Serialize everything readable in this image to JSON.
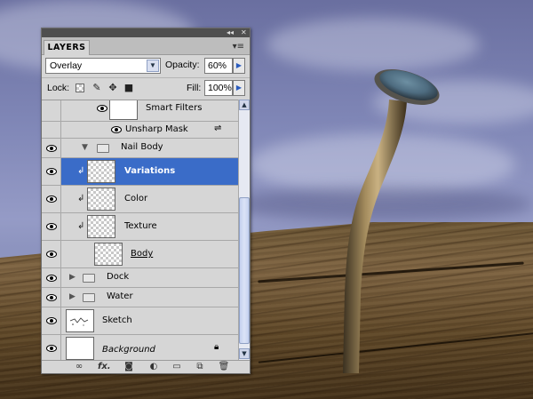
{
  "panel": {
    "tab_label": "LAYERS",
    "menu_icon": "panel-menu-icon",
    "collapse_glyph": "◂◂",
    "close_glyph": "✕",
    "blend_mode": "Overlay",
    "opacity_label": "Opacity:",
    "opacity_value": "60%",
    "lock_label": "Lock:",
    "fill_label": "Fill:",
    "fill_value": "100%"
  },
  "layers": [
    {
      "name": "Smart Filters",
      "kind": "smart-filters"
    },
    {
      "name": "Unsharp Mask",
      "kind": "filter"
    },
    {
      "name": "Nail Body",
      "kind": "group-open"
    },
    {
      "name": "Variations",
      "kind": "clipped",
      "selected": true
    },
    {
      "name": "Color",
      "kind": "clipped"
    },
    {
      "name": "Texture",
      "kind": "clipped"
    },
    {
      "name": "Body",
      "kind": "base"
    },
    {
      "name": "Dock",
      "kind": "group-closed"
    },
    {
      "name": "Water",
      "kind": "group-closed"
    },
    {
      "name": "Sketch",
      "kind": "layer"
    },
    {
      "name": "Background",
      "kind": "background"
    }
  ],
  "footer_icons": [
    "link-layers-icon",
    "fx-icon",
    "layer-mask-icon",
    "adjustment-layer-icon",
    "new-group-icon",
    "new-layer-icon",
    "trash-icon"
  ],
  "colors": {
    "selection": "#3a6cc8",
    "panel": "#d6d6d6"
  }
}
